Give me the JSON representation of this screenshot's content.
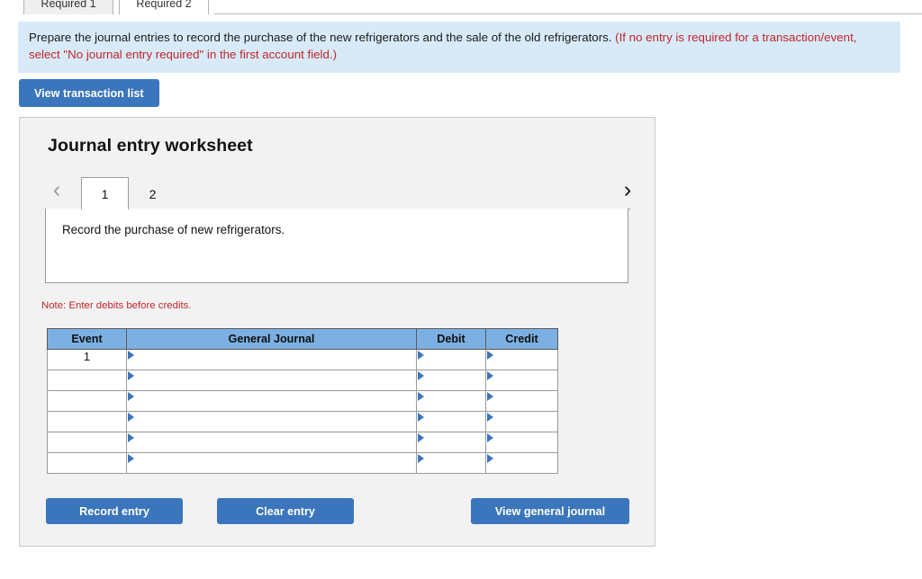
{
  "tabs": [
    {
      "label": "Required 1",
      "active": false
    },
    {
      "label": "Required 2",
      "active": true
    }
  ],
  "banner": {
    "main_text": "Prepare the journal entries to record the purchase of the new refrigerators and the sale of the old refrigerators. ",
    "hint_text": "(If no entry is required for a transaction/event, select \"No journal entry required\" in the first account field.)"
  },
  "toolbar": {
    "view_transaction_list_label": "View transaction list"
  },
  "worksheet": {
    "title": "Journal entry worksheet",
    "pager": {
      "prev_icon": "chevron-left-icon",
      "next_icon": "chevron-right-icon",
      "pages": [
        {
          "label": "1",
          "active": true
        },
        {
          "label": "2",
          "active": false
        }
      ]
    },
    "description": "Record the purchase of new refrigerators.",
    "note": "Note: Enter debits before credits.",
    "table": {
      "columns": [
        "Event",
        "General Journal",
        "Debit",
        "Credit"
      ],
      "rows": [
        {
          "event": "1",
          "general_journal": "",
          "debit": "",
          "credit": ""
        },
        {
          "event": "",
          "general_journal": "",
          "debit": "",
          "credit": ""
        },
        {
          "event": "",
          "general_journal": "",
          "debit": "",
          "credit": ""
        },
        {
          "event": "",
          "general_journal": "",
          "debit": "",
          "credit": ""
        },
        {
          "event": "",
          "general_journal": "",
          "debit": "",
          "credit": ""
        },
        {
          "event": "",
          "general_journal": "",
          "debit": "",
          "credit": ""
        }
      ]
    },
    "buttons": {
      "record_entry_label": "Record entry",
      "clear_entry_label": "Clear entry",
      "view_general_journal_label": "View general journal"
    }
  },
  "colors": {
    "accent_blue": "#3b76bc",
    "table_header_blue": "#7cb0e2",
    "banner_blue": "#d8eaf7",
    "hint_red": "#c0262c",
    "panel_gray": "#f2f2f2"
  }
}
